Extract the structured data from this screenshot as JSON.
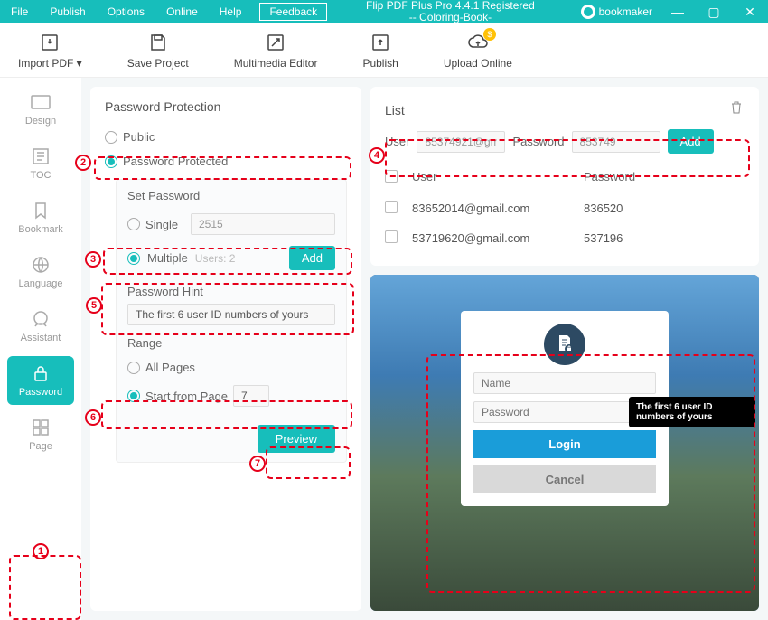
{
  "titlebar": {
    "menu": [
      "File",
      "Publish",
      "Options",
      "Online",
      "Help"
    ],
    "feedback": "Feedback",
    "title_line1": "Flip PDF Plus Pro 4.4.1 Registered",
    "title_line2": "-- Coloring-Book-",
    "username": "bookmaker",
    "win": {
      "min": "—",
      "max": "▢",
      "close": "✕"
    }
  },
  "toolbar": {
    "import_pdf": "Import PDF",
    "save_project": "Save Project",
    "multimedia_editor": "Multimedia Editor",
    "publish": "Publish",
    "upload_online": "Upload Online",
    "dollar": "$"
  },
  "sidebar": {
    "items": [
      {
        "label": "Design"
      },
      {
        "label": "TOC"
      },
      {
        "label": "Bookmark"
      },
      {
        "label": "Language"
      },
      {
        "label": "Assistant"
      },
      {
        "label": "Password"
      },
      {
        "label": "Page"
      }
    ]
  },
  "password_panel": {
    "heading": "Password Protection",
    "public": "Public",
    "protected": "Password Protected",
    "set_password": "Set Password",
    "single": "Single",
    "single_value": "2515",
    "multiple": "Multiple",
    "users_count": "Users: 2",
    "add": "Add",
    "hint_label": "Password Hint",
    "hint_value": "The first 6 user ID numbers of yours",
    "range": "Range",
    "all_pages": "All Pages",
    "start_from": "Start from Page",
    "start_value": "7",
    "preview": "Preview"
  },
  "list_panel": {
    "heading": "List",
    "user_label": "User",
    "user_input": "85374921@gm",
    "password_label": "Password",
    "password_input": "853749",
    "add": "Add",
    "col_user": "User",
    "col_password": "Password",
    "rows": [
      {
        "user": "83652014@gmail.com",
        "password": "836520"
      },
      {
        "user": "53719620@gmail.com",
        "password": "537196"
      }
    ]
  },
  "preview_modal": {
    "name_ph": "Name",
    "password_ph": "Password",
    "login": "Login",
    "cancel": "Cancel",
    "tooltip": "The first 6 user ID numbers of yours"
  }
}
